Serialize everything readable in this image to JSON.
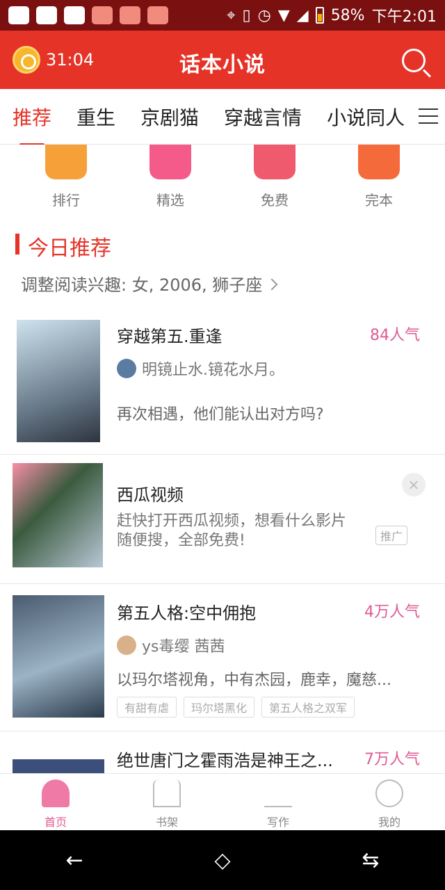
{
  "status_bar": {
    "battery": "58%",
    "clock": "下午2:01"
  },
  "header": {
    "timer": "31:04",
    "title": "话本小说"
  },
  "tabs": [
    "推荐",
    "重生",
    "京剧猫",
    "穿越言情",
    "小说同人"
  ],
  "quick": [
    {
      "label": "排行",
      "color": "#f6a03a"
    },
    {
      "label": "精选",
      "color": "#f45a8a"
    },
    {
      "label": "免费",
      "color": "#f05a6f"
    },
    {
      "label": "完本",
      "color": "#f56a3a"
    }
  ],
  "section": {
    "title": "今日推荐",
    "interest": "调整阅读兴趣: 女, 2006, 狮子座"
  },
  "books": [
    {
      "title": "穿越第五.重逢",
      "popularity": "84人气",
      "author": "明镜止水.镜花水月。",
      "desc": "再次相遇，他们能认出对方吗?"
    },
    {
      "title": "第五人格:空中佣抱",
      "popularity": "4万人气",
      "author": "ys毒缨 茜茜",
      "desc": "以玛尔塔视角，中有杰园，鹿幸，魔慈...",
      "tags": [
        "有甜有虐",
        "玛尔塔黑化",
        "第五人格之双军"
      ]
    },
    {
      "title": "绝世唐门之霍雨浩是神王之...",
      "popularity": "7万人气"
    }
  ],
  "ad": {
    "title": "西瓜视频",
    "desc": "赶快打开西瓜视频，想看什么影片随便搜，全部免费!",
    "badge": "推广",
    "close": "×"
  },
  "bottom_nav": [
    "首页",
    "书架",
    "写作",
    "我的"
  ],
  "colors": {
    "accent": "#e53328",
    "pink": "#e05a93"
  }
}
